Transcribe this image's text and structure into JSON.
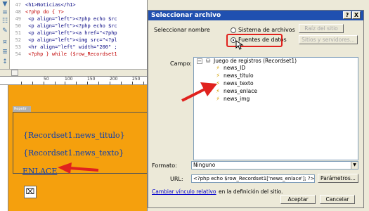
{
  "code": {
    "lines": [
      {
        "num": "47",
        "text": "<h1>Noticias</h1>"
      },
      {
        "num": "48",
        "text": "<?php do { ?>"
      },
      {
        "num": "49",
        "text": "  <p align=\"left\"><?php echo $rc"
      },
      {
        "num": "50",
        "text": "  <p align=\"left\"><?php echo $rc"
      },
      {
        "num": "51",
        "text": "  <p align=\"left\"><a href=\"<?php"
      },
      {
        "num": "52",
        "text": "  <p align=\"left\"><img src=\"<?pl"
      },
      {
        "num": "53",
        "text": "  <hr align=\"left\" width=\"200\" ;"
      },
      {
        "num": "54",
        "text": "  <?php } while ($row_Recordset1"
      }
    ]
  },
  "ruler": {
    "ticks": [
      "50",
      "100",
      "150",
      "200",
      "250"
    ]
  },
  "design": {
    "repeat_label": "Repetir",
    "field_titulo": "{Recordset1.news_titulo}",
    "field_texto": "{Recordset1.news_texto}",
    "enlace": "ENLACE"
  },
  "dialog": {
    "title": "Seleccionar archivo",
    "help_btn": "?",
    "close_btn": "X",
    "select_label": "Seleccionar nombre",
    "radio_filesystem": "Sistema de archivos",
    "radio_datasources": "Fuentes de datos",
    "btn_site_root": "Raíz del sitio",
    "btn_sites_servers": "Sitios y servidores...",
    "campo_label": "Campo:",
    "tree": {
      "root": "Juego de registros (Recordset1)",
      "fields": [
        "news_ID",
        "news_titulo",
        "news_texto",
        "news_enlace",
        "news_img"
      ],
      "selected_index": 3
    },
    "formato_label": "Formato:",
    "formato_value": "Ninguno",
    "url_label": "URL:",
    "url_value": "<?php echo $row_Recordset1['news_enlace']; ?>",
    "btn_parametros": "Parámetros...",
    "change_link": "Cambiar vínculo relativo",
    "change_text": "en la definición del sitio.",
    "btn_accept": "Aceptar",
    "btn_cancel": "Cancelar"
  },
  "colors": {
    "accent": "#e0221e",
    "design_bg": "#f5a00d",
    "selection": "#0a246a"
  }
}
